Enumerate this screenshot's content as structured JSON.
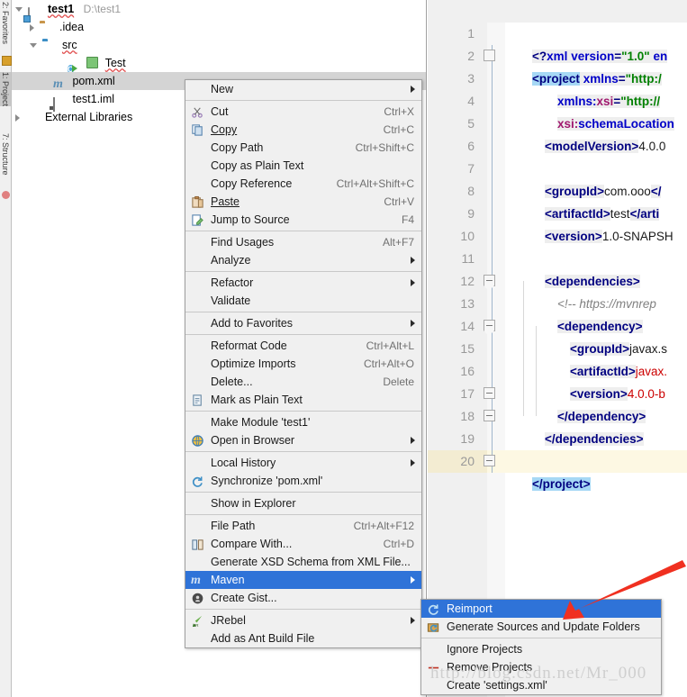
{
  "toolstrip": {
    "labels": [
      {
        "text": "2: Favorites",
        "selected": false
      },
      {
        "text": "1: Project",
        "selected": true
      },
      {
        "text": "7: Structure",
        "selected": false
      }
    ]
  },
  "project_tree": {
    "nodes": [
      {
        "label": "test1",
        "path": "D:\\test1",
        "icon": "module-icon",
        "expander": "down",
        "bold": true,
        "selected": false,
        "indent": 18
      },
      {
        "label": ".idea",
        "path": "",
        "icon": "folder-tan-icon",
        "expander": "right",
        "bold": false,
        "selected": false,
        "indent": 34
      },
      {
        "label": "src",
        "path": "",
        "icon": "folder-blue-icon",
        "expander": "down",
        "bold": false,
        "selected": false,
        "indent": 34
      },
      {
        "label": "Test",
        "path": "",
        "icon": "java-class-icon",
        "expander": "none",
        "bold": false,
        "selected": false,
        "indent": 56
      },
      {
        "label": "pom.xml",
        "path": "",
        "icon": "maven-m-icon",
        "expander": "none",
        "bold": false,
        "selected": true,
        "indent": 44
      },
      {
        "label": "test1.iml",
        "path": "",
        "icon": "file-icon",
        "expander": "none",
        "bold": false,
        "selected": false,
        "indent": 44
      },
      {
        "label": "External Libraries",
        "path": "",
        "icon": "library-icon",
        "expander": "right",
        "bold": false,
        "selected": false,
        "indent": 10
      }
    ]
  },
  "editor": {
    "lines": [
      {
        "num": "1",
        "indent": 0
      },
      {
        "num": "2",
        "indent": 0
      },
      {
        "num": "3",
        "indent": 0
      },
      {
        "num": "4",
        "indent": 0
      },
      {
        "num": "5",
        "indent": 0
      },
      {
        "num": "6",
        "indent": 0
      },
      {
        "num": "7",
        "indent": 0
      },
      {
        "num": "8",
        "indent": 0
      },
      {
        "num": "9",
        "indent": 0
      },
      {
        "num": "10",
        "indent": 0
      },
      {
        "num": "11",
        "indent": 0
      },
      {
        "num": "12",
        "indent": 0
      },
      {
        "num": "13",
        "indent": 0
      },
      {
        "num": "14",
        "indent": 0
      },
      {
        "num": "15",
        "indent": 0
      },
      {
        "num": "16",
        "indent": 0
      },
      {
        "num": "17",
        "indent": 0
      },
      {
        "num": "18",
        "indent": 0
      },
      {
        "num": "19",
        "indent": 0
      },
      {
        "num": "20",
        "indent": 0
      }
    ],
    "code_text": {
      "l1": "<?xml version=\"1.0\" en",
      "l2": "<project xmlns=\"http:/",
      "l3": "xmlns:xsi=\"http://",
      "l4": "xsi:schemaLocation",
      "l5": "<modelVersion>4.0.0",
      "l7": "<groupId>com.ooo</",
      "l8": "<artifactId>test</arti",
      "l9": "<version>1.0-SNAPSH",
      "l11": "<dependencies>",
      "l12": "<!-- https://mvnrep",
      "l13": "<dependency>",
      "l14": "<groupId>javax.s",
      "l15": "<artifactId>javax.",
      "l16": "<version>4.0.0-b",
      "l17": "</dependency>",
      "l18": "</dependencies>",
      "l20": "</project>"
    },
    "current_line": "20"
  },
  "context_menu": {
    "items": [
      {
        "label": "New",
        "accel": "",
        "icon": "",
        "submenu": true,
        "mnemonic": "N",
        "sep_after": true
      },
      {
        "label": "Cut",
        "accel": "Ctrl+X",
        "icon": "scissors-icon",
        "submenu": false,
        "mnemonic": "t"
      },
      {
        "label": "Copy",
        "accel": "Ctrl+C",
        "icon": "copy-icon",
        "submenu": false,
        "mnemonic": "C"
      },
      {
        "label": "Copy Path",
        "accel": "Ctrl+Shift+C",
        "icon": "",
        "submenu": false,
        "mnemonic": "o"
      },
      {
        "label": "Copy as Plain Text",
        "accel": "",
        "icon": "",
        "submenu": false,
        "mnemonic": ""
      },
      {
        "label": "Copy Reference",
        "accel": "Ctrl+Alt+Shift+C",
        "icon": "",
        "submenu": false,
        "mnemonic": "y"
      },
      {
        "label": "Paste",
        "accel": "Ctrl+V",
        "icon": "paste-icon",
        "submenu": false,
        "mnemonic": "P"
      },
      {
        "label": "Jump to Source",
        "accel": "F4",
        "icon": "jump-to-source-icon",
        "submenu": false,
        "mnemonic": "J",
        "sep_after": true
      },
      {
        "label": "Find Usages",
        "accel": "Alt+F7",
        "icon": "",
        "submenu": false,
        "mnemonic": "U"
      },
      {
        "label": "Analyze",
        "accel": "",
        "icon": "",
        "submenu": true,
        "mnemonic": "z",
        "sep_after": true
      },
      {
        "label": "Refactor",
        "accel": "",
        "icon": "",
        "submenu": true,
        "mnemonic": "R"
      },
      {
        "label": "Validate",
        "accel": "",
        "icon": "",
        "submenu": false,
        "mnemonic": "V",
        "sep_after": true
      },
      {
        "label": "Add to Favorites",
        "accel": "",
        "icon": "",
        "submenu": true,
        "mnemonic": "F",
        "sep_after": true
      },
      {
        "label": "Reformat Code",
        "accel": "Ctrl+Alt+L",
        "icon": "",
        "submenu": false,
        "mnemonic": "R"
      },
      {
        "label": "Optimize Imports",
        "accel": "Ctrl+Alt+O",
        "icon": "",
        "submenu": false,
        "mnemonic": "z"
      },
      {
        "label": "Delete...",
        "accel": "Delete",
        "icon": "",
        "submenu": false,
        "mnemonic": "D"
      },
      {
        "label": "Mark as Plain Text",
        "accel": "",
        "icon": "mark-plain-text-icon",
        "submenu": false,
        "mnemonic": "",
        "sep_after": true
      },
      {
        "label": "Make Module 'test1'",
        "accel": "",
        "icon": "",
        "submenu": false,
        "mnemonic": "M"
      },
      {
        "label": "Open in Browser",
        "accel": "",
        "icon": "browser-icon",
        "submenu": true,
        "mnemonic": "B",
        "sep_after": true
      },
      {
        "label": "Local History",
        "accel": "",
        "icon": "",
        "submenu": true,
        "mnemonic": "H"
      },
      {
        "label": "Synchronize 'pom.xml'",
        "accel": "",
        "icon": "sync-icon",
        "submenu": false,
        "mnemonic": "",
        "sep_after": true
      },
      {
        "label": "Show in Explorer",
        "accel": "",
        "icon": "",
        "submenu": false,
        "mnemonic": "",
        "sep_after": true
      },
      {
        "label": "File Path",
        "accel": "Ctrl+Alt+F12",
        "icon": "",
        "submenu": false,
        "mnemonic": "P"
      },
      {
        "label": "Compare With...",
        "accel": "Ctrl+D",
        "icon": "compare-icon",
        "submenu": false,
        "mnemonic": "W"
      },
      {
        "label": "Generate XSD Schema from XML File...",
        "accel": "",
        "icon": "",
        "submenu": false,
        "mnemonic": ""
      },
      {
        "label": "Maven",
        "accel": "",
        "icon": "maven-m-icon",
        "submenu": true,
        "mnemonic": "",
        "highlighted": true
      },
      {
        "label": "Create Gist...",
        "accel": "",
        "icon": "github-icon",
        "submenu": false,
        "mnemonic": "",
        "sep_after": true
      },
      {
        "label": "JRebel",
        "accel": "",
        "icon": "jrebel-icon",
        "submenu": true,
        "mnemonic": ""
      },
      {
        "label": "Add as Ant Build File",
        "accel": "",
        "icon": "",
        "submenu": false,
        "mnemonic": "nt"
      }
    ]
  },
  "maven_submenu": {
    "items": [
      {
        "label": "Reimport",
        "icon": "reimport-icon",
        "highlighted": true
      },
      {
        "label": "Generate Sources and Update Folders",
        "icon": "generate-sources-icon",
        "sep_after": true
      },
      {
        "label": "Ignore Projects",
        "icon": ""
      },
      {
        "label": "Remove Projects",
        "icon": "remove-icon"
      },
      {
        "label": "Create 'settings.xml'",
        "icon": ""
      }
    ]
  },
  "annotation": {
    "arrow_color": "#f03020",
    "watermark": "http://blog.csdn.net/Mr_000"
  },
  "colors": {
    "menu_bg": "#f0f0f0",
    "highlight_blue": "#2f73d8",
    "tree_selected": "#d4d4d4",
    "current_line": "#fdf8e3"
  }
}
